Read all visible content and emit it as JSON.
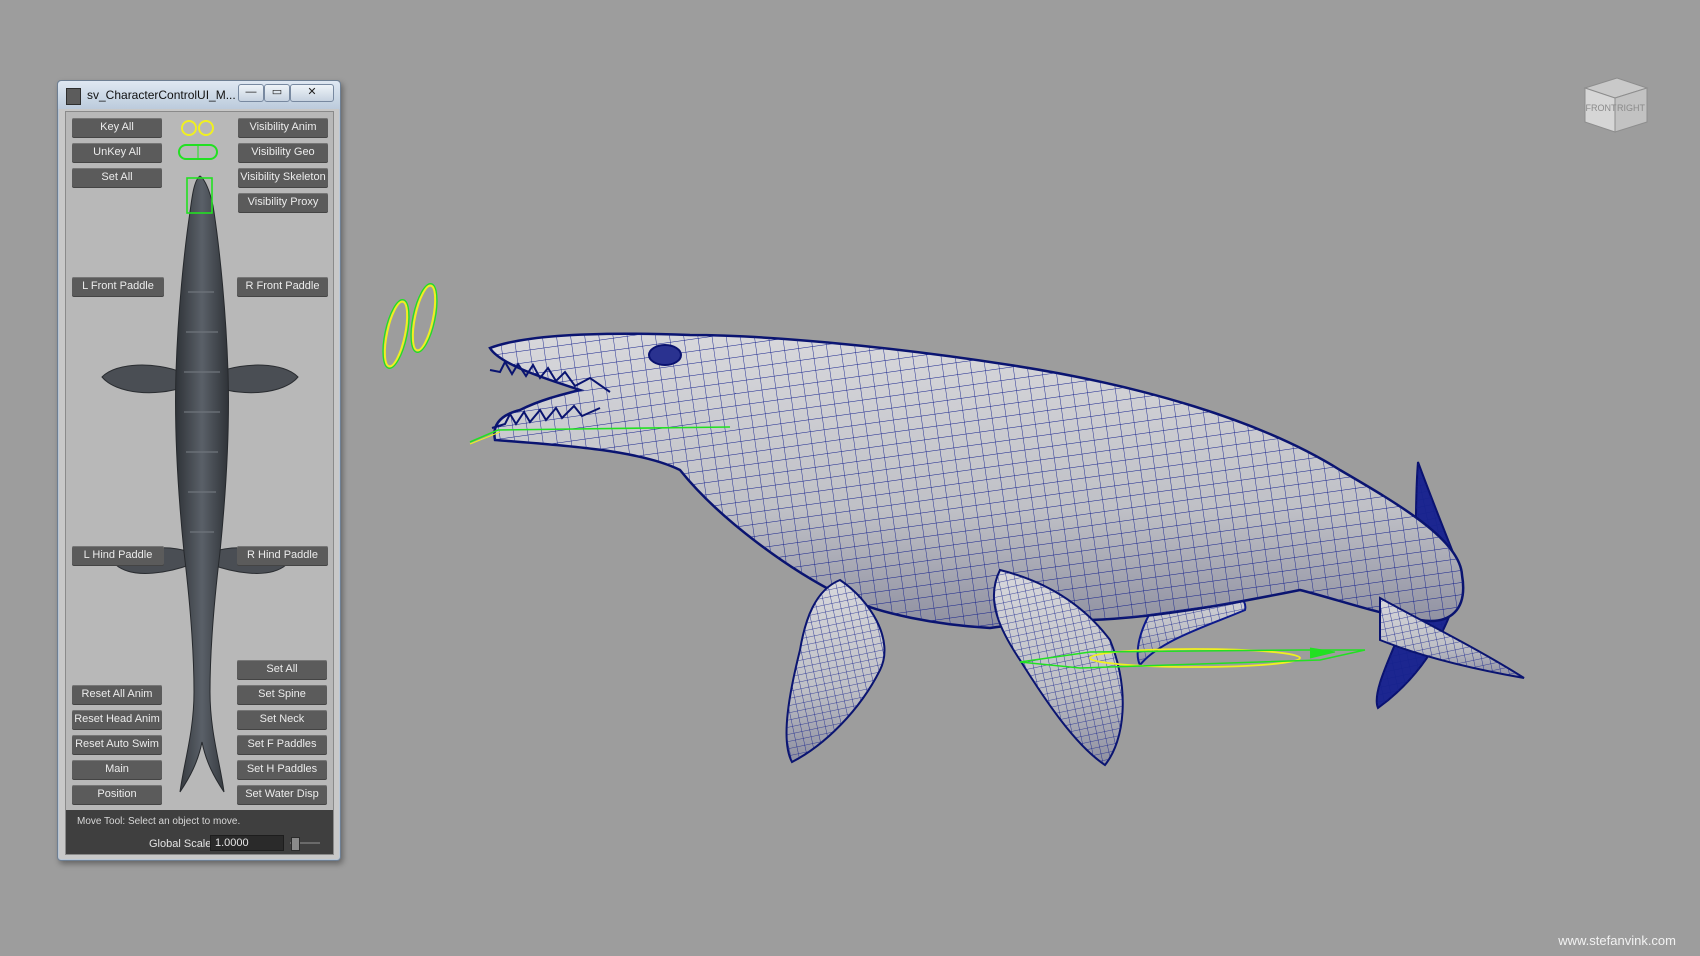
{
  "window": {
    "title": "sv_CharacterControlUI_M...",
    "buttons": {
      "minimize": "—",
      "maximize": "▭",
      "close": "✕"
    }
  },
  "panel": {
    "key_all": "Key All",
    "unkey_all": "UnKey All",
    "set_all_top": "Set All",
    "visibility_anim": "Visibility Anim",
    "visibility_geo": "Visibility Geo",
    "visibility_skeleton": "Visibility Skeleton",
    "visibility_proxy": "Visibility Proxy",
    "l_front_paddle": "L Front Paddle",
    "r_front_paddle": "R Front Paddle",
    "l_hind_paddle": "L Hind Paddle",
    "r_hind_paddle": "R Hind Paddle",
    "set_all_bottom": "Set All",
    "reset_all_anim": "Reset All Anim",
    "set_spine": "Set Spine",
    "reset_head_anim": "Reset Head Anim",
    "set_neck": "Set Neck",
    "reset_auto_swim": "Reset Auto Swim",
    "set_f_paddles": "Set F Paddles",
    "main": "Main",
    "set_h_paddles": "Set H Paddles",
    "position": "Position",
    "set_water_disp": "Set Water Disp"
  },
  "status": {
    "help_text": "Move Tool: Select an object to move.",
    "global_scale_label": "Global Scale",
    "global_scale_value": "1.0000"
  },
  "viewcube": {
    "front": "FRONT",
    "right": "RIGHT"
  },
  "watermark": "www.stefanvink.com",
  "colors": {
    "viewport_bg": "#9d9d9d",
    "wireframe": "#0d1a8c",
    "control_green": "#22e022",
    "control_yellow": "#f0f020"
  },
  "icons": {
    "window_app": "maya-app-icon",
    "eye_controls": "eye-control-circles",
    "jaw_control": "jaw-control-capsule",
    "head_control": "head-control-box"
  }
}
